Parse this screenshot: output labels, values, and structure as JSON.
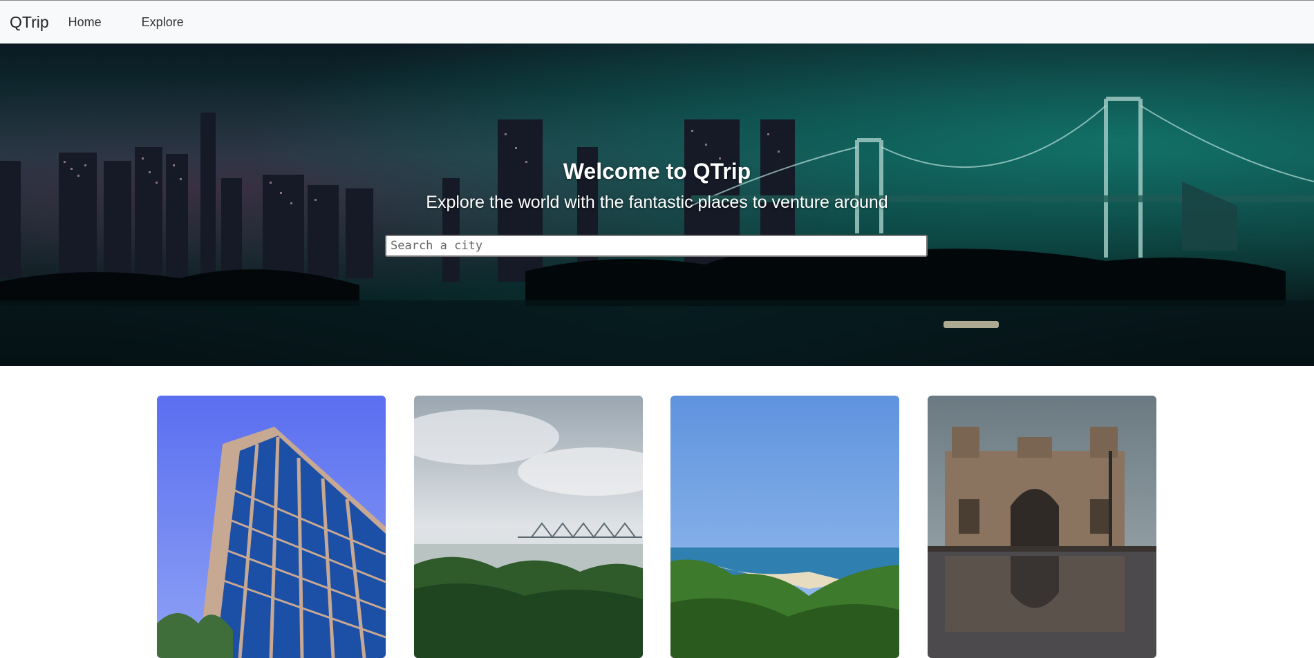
{
  "navbar": {
    "brand": "QTrip",
    "links": [
      {
        "label": "Home"
      },
      {
        "label": "Explore"
      }
    ]
  },
  "hero": {
    "title": "Welcome to QTrip",
    "subtitle": "Explore the world with the fantastic places to venture around",
    "search": {
      "placeholder": "Search a city",
      "value": ""
    }
  },
  "cities": [
    {
      "image": "glass-office-tower-photo"
    },
    {
      "image": "river-bridge-greenery-photo"
    },
    {
      "image": "coastal-beach-photo"
    },
    {
      "image": "gateway-monument-photo"
    }
  ],
  "colors": {
    "navbar_bg": "#f8f9fa",
    "hero_text": "#ffffff",
    "hero_teal": "#0f3a3d"
  }
}
